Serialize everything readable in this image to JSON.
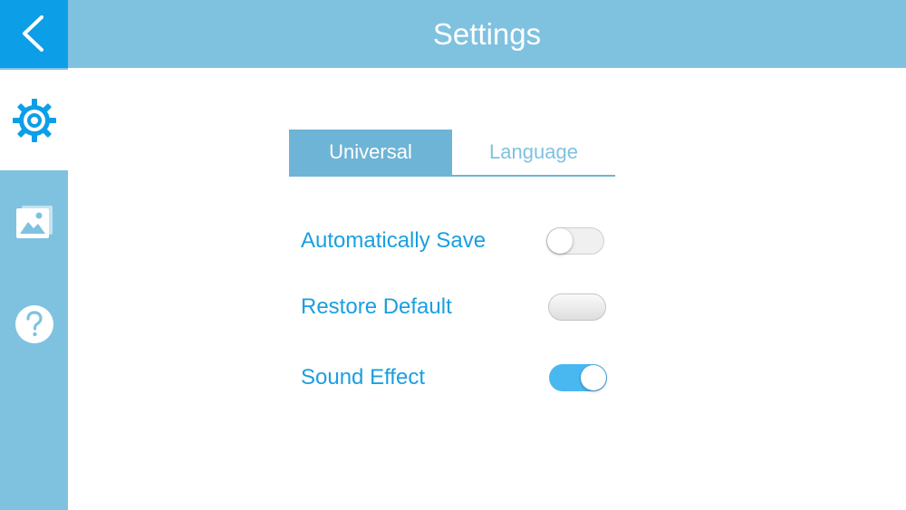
{
  "header": {
    "title": "Settings"
  },
  "sidebar": {
    "items": [
      {
        "icon": "gear-icon",
        "active": true
      },
      {
        "icon": "gallery-icon",
        "active": false
      },
      {
        "icon": "help-icon",
        "active": false
      }
    ]
  },
  "tabs": [
    {
      "label": "Universal",
      "selected": true
    },
    {
      "label": "Language",
      "selected": false
    }
  ],
  "settings": [
    {
      "label": "Automatically Save",
      "state": "off"
    },
    {
      "label": "Restore Default",
      "state": "button"
    },
    {
      "label": "Sound Effect",
      "state": "on"
    }
  ],
  "colors": {
    "header": "#7fc2e0",
    "back_button": "#0d9ee8",
    "accent_text": "#1a9fe0",
    "toggle_on": "#4ab8f0"
  }
}
